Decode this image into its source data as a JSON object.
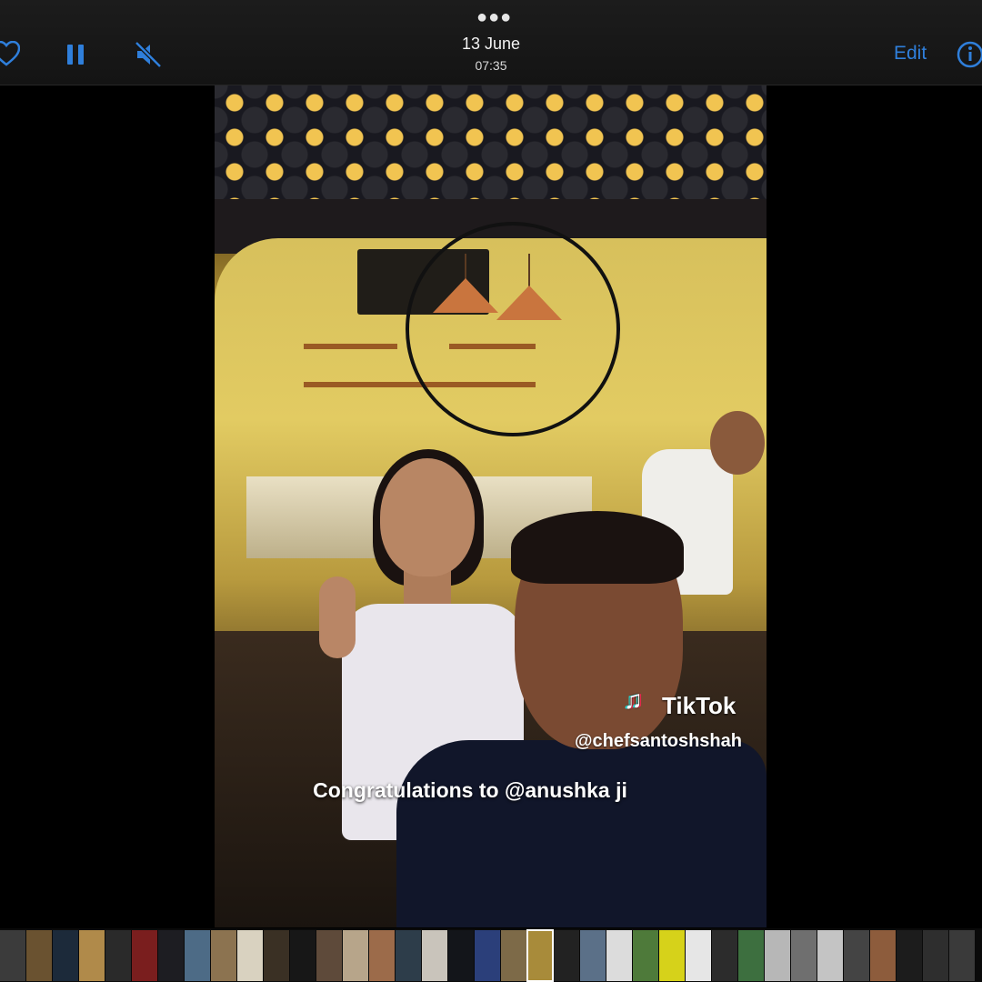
{
  "topbar": {
    "date": "13 June",
    "time": "07:35",
    "edit_label": "Edit",
    "icons": [
      "heart-icon",
      "pause-icon",
      "mute-icon",
      "more-icon",
      "info-icon"
    ],
    "accent_color": "#2f7fdb"
  },
  "video": {
    "overlay_brand": "TikTok",
    "overlay_handle": "@chefsantoshshah",
    "caption": "Congratulations to @anushka ji"
  },
  "thumbnail_strip": {
    "colors": [
      "#3b3b3b",
      "#6a5230",
      "#1c2a3a",
      "#b08a4a",
      "#2a2a2a",
      "#7a1e1e",
      "#1d1d22",
      "#4d6b86",
      "#8c7350",
      "#d9d2c0",
      "#3a3024",
      "#171717",
      "#5e4a3a",
      "#b7a58a",
      "#9c6b4a",
      "#2d3d4a",
      "#c9c4bb",
      "#13151a",
      "#2b3f7a",
      "#7d6a48",
      "#a88b3a",
      "#222",
      "#5b7088",
      "#dcdcdc",
      "#4e7a3a",
      "#d6d21a",
      "#e6e6e6",
      "#2c2c2c",
      "#3d6f3f",
      "#b7b7b7",
      "#6f6f6f",
      "#c4c4c4",
      "#444",
      "#8d5c3c",
      "#1c1c1c",
      "#2e2e2e",
      "#3a3a3a"
    ],
    "active_index": 20
  }
}
